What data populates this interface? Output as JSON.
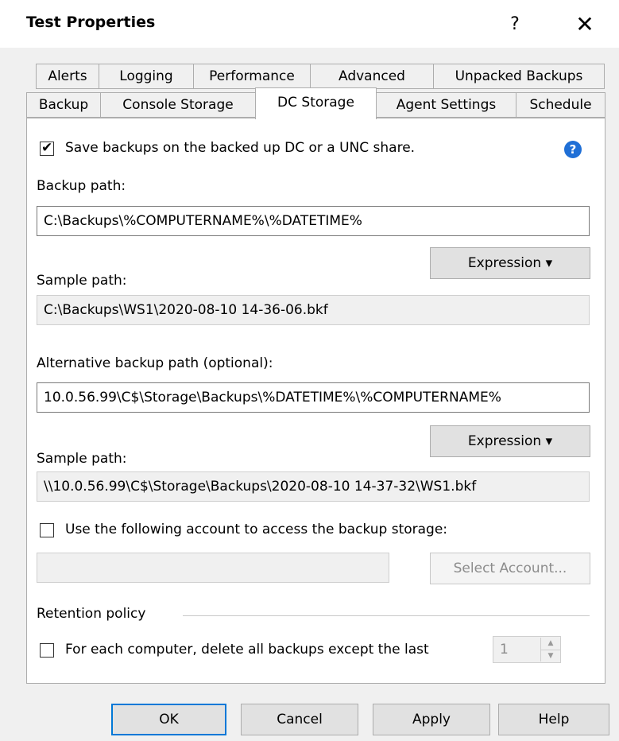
{
  "window": {
    "title": "Test Properties",
    "help_glyph": "?",
    "close_glyph": "✕"
  },
  "tabs_row1": [
    "Alerts",
    "Logging",
    "Performance",
    "Advanced",
    "Unpacked Backups"
  ],
  "tabs_row2": [
    "Backup",
    "Console Storage",
    "DC Storage",
    "Agent Settings",
    "Schedule"
  ],
  "active_tab": "DC Storage",
  "dc_storage": {
    "save_checkbox": {
      "checked": true,
      "label": "Save backups on the backed up DC or a UNC share."
    },
    "help_icon": "help-circle-icon",
    "backup_path_label": "Backup path:",
    "backup_path_value": "C:\\Backups\\%COMPUTERNAME%\\%DATETIME%",
    "expression_label": "Expression ▾",
    "sample_path_label": "Sample path:",
    "sample_path_value": "C:\\Backups\\WS1\\2020-08-10 14-36-06.bkf",
    "alt_path_label": "Alternative backup path (optional):",
    "alt_path_value": "10.0.56.99\\C$\\Storage\\Backups\\%DATETIME%\\%COMPUTERNAME%",
    "alt_sample_label": "Sample path:",
    "alt_sample_value": "\\\\10.0.56.99\\C$\\Storage\\Backups\\2020-08-10 14-37-32\\WS1.bkf",
    "account_checkbox": {
      "checked": false,
      "label": "Use the following account to access the backup storage:"
    },
    "account_value": "",
    "select_account_label": "Select Account...",
    "retention_label": "Retention policy",
    "retention_checkbox": {
      "checked": false,
      "label": "For each computer, delete all backups except the last"
    },
    "retention_count": "1"
  },
  "footer": {
    "ok": "OK",
    "cancel": "Cancel",
    "apply": "Apply",
    "help": "Help"
  },
  "colors": {
    "accent": "#0078d7",
    "help_icon_bg": "#1f6fd6"
  }
}
